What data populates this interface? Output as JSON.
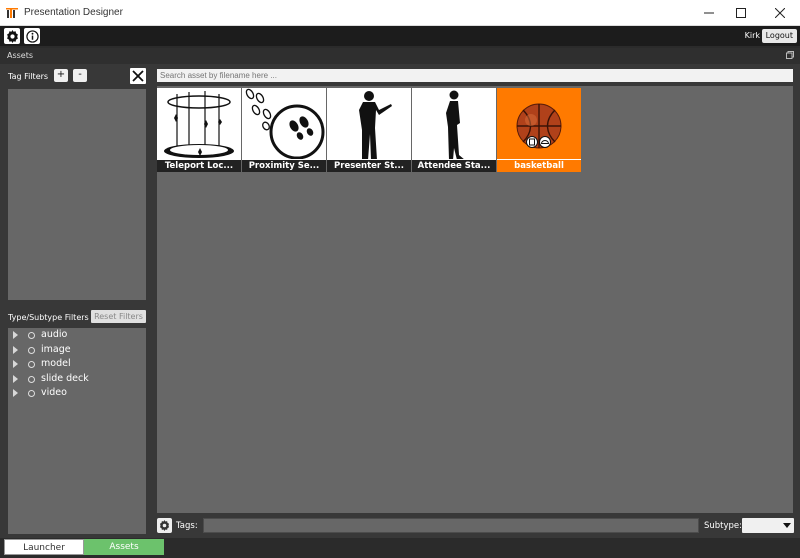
{
  "window": {
    "title": "Presentation Designer"
  },
  "toolbar": {
    "user_name": "Kirk",
    "logout_label": "Logout"
  },
  "panel": {
    "title": "Assets"
  },
  "left": {
    "tag_filters_label": "Tag Filters",
    "add_label": "+",
    "remove_label": "-",
    "type_filters_label": "Type/Subtype Filters",
    "reset_filters_label": "Reset Filters",
    "types": [
      "audio",
      "image",
      "model",
      "slide deck",
      "video"
    ]
  },
  "main": {
    "search_placeholder": "Search asset by filename here ...",
    "assets": [
      {
        "name": "Teleport Loc...",
        "icon": "teleport-icon",
        "selected": false
      },
      {
        "name": "Proximity Se...",
        "icon": "proximity-icon",
        "selected": false
      },
      {
        "name": "Presenter St...",
        "icon": "presenter-icon",
        "selected": false
      },
      {
        "name": "Attendee Sta...",
        "icon": "attendee-icon",
        "selected": false
      },
      {
        "name": "basketball",
        "icon": "basketball-icon",
        "selected": true
      }
    ],
    "tags_label": "Tags:",
    "subtype_label": "Subtype:"
  },
  "tabs": {
    "launcher": "Launcher",
    "assets": "Assets"
  },
  "colors": {
    "accent_selected": "#ff7a00",
    "tab_active": "#6cc26c"
  }
}
